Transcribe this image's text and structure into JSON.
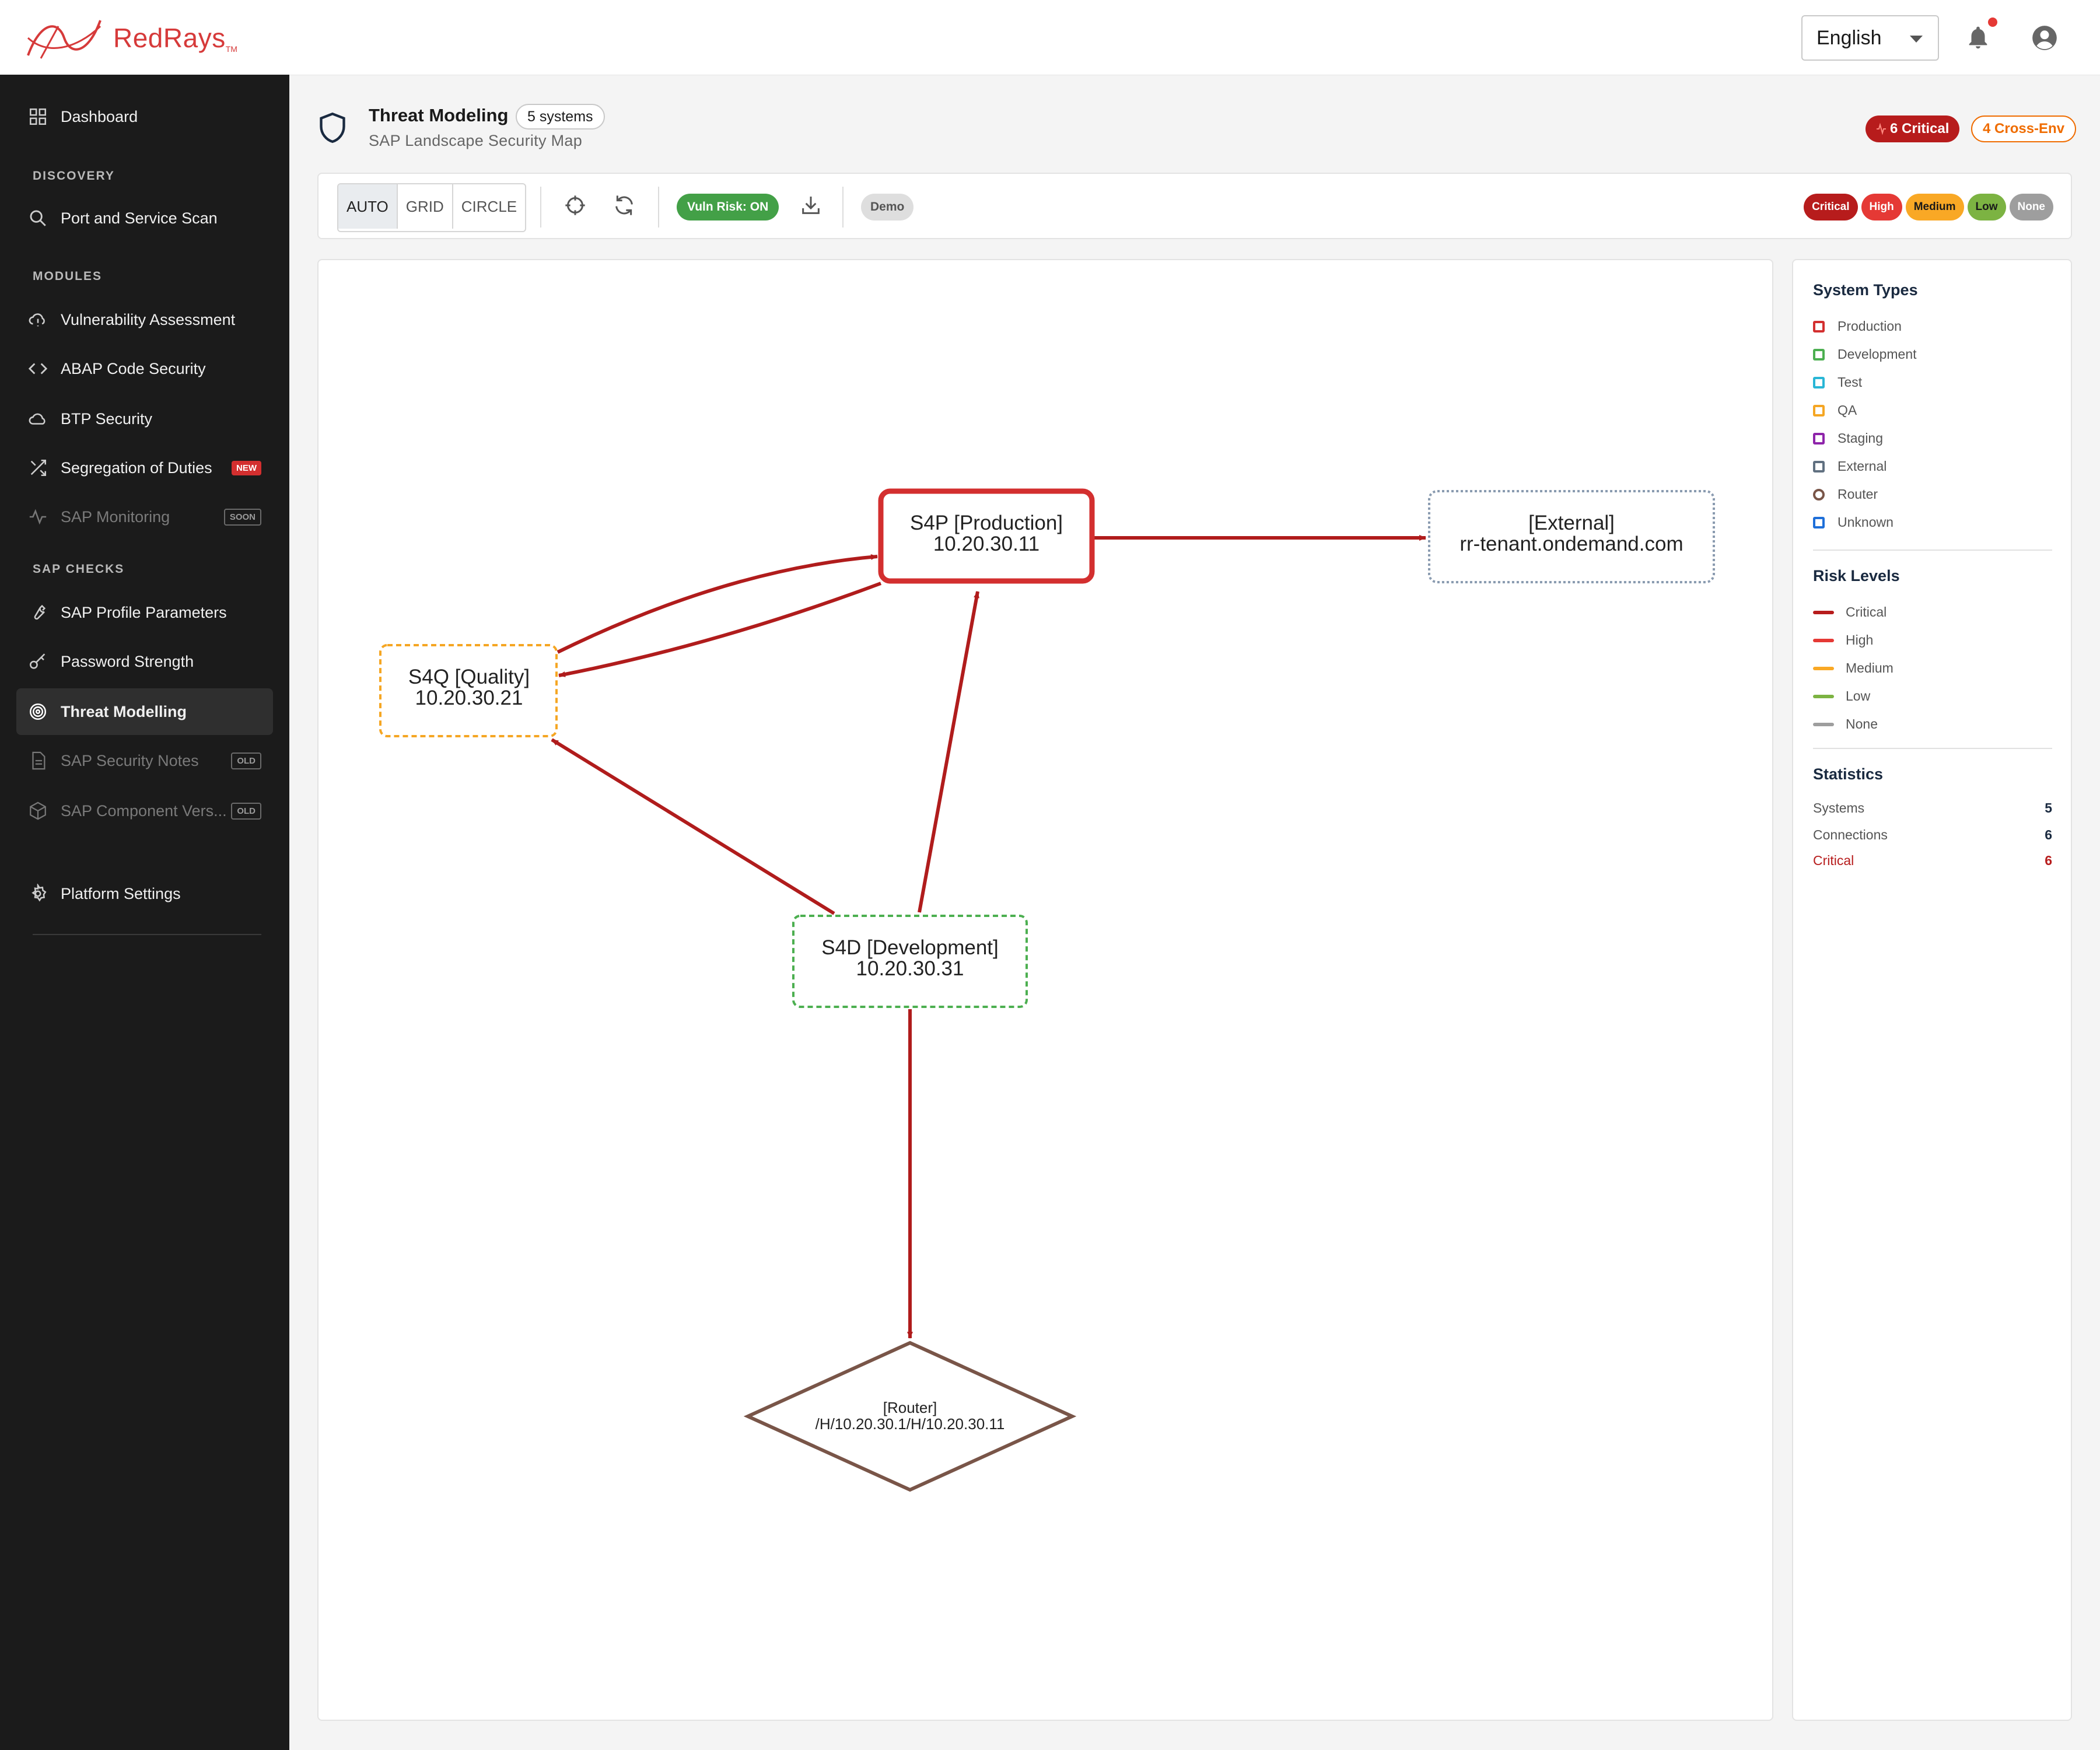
{
  "brand": {
    "name": "RedRays",
    "tm": "TM"
  },
  "header": {
    "language": "English",
    "bell_icon": "bell-icon",
    "account_icon": "account-icon"
  },
  "sidebar": {
    "dashboard": "Dashboard",
    "sections": {
      "discovery": "DISCOVERY",
      "modules": "MODULES",
      "sap_checks": "SAP CHECKS"
    },
    "items": {
      "port_scan": "Port and Service Scan",
      "vuln": "Vulnerability Assessment",
      "abap": "ABAP Code Security",
      "btp": "BTP Security",
      "sod": "Segregation of Duties",
      "sod_tag": "NEW",
      "monitoring": "SAP Monitoring",
      "monitoring_tag": "SOON",
      "profile": "SAP Profile Parameters",
      "password": "Password Strength",
      "threat": "Threat Modelling",
      "notes": "SAP Security Notes",
      "notes_tag": "OLD",
      "component": "SAP Component Vers...",
      "component_tag": "OLD",
      "settings": "Platform Settings"
    }
  },
  "page": {
    "title": "Threat Modeling",
    "count": "5 systems",
    "subtitle": "SAP Landscape Security Map",
    "critical_badge": "6 Critical",
    "cross_badge": "4 Cross-Env"
  },
  "toolbar": {
    "layouts": [
      "AUTO",
      "GRID",
      "CIRCLE"
    ],
    "active_layout": "AUTO",
    "vuln_risk": "Vuln Risk: ON",
    "demo": "Demo",
    "risk_pills": [
      {
        "label": "Critical",
        "bg": "#b71c1c",
        "fg": "#ffffff"
      },
      {
        "label": "High",
        "bg": "#e53935",
        "fg": "#ffffff"
      },
      {
        "label": "Medium",
        "bg": "#f9a825",
        "fg": "#1a1a1a"
      },
      {
        "label": "Low",
        "bg": "#7cb342",
        "fg": "#1a1a1a"
      },
      {
        "label": "None",
        "bg": "#9e9e9e",
        "fg": "#ffffff"
      }
    ]
  },
  "graph": {
    "nodes": {
      "s4p": {
        "line1": "S4P [Production]",
        "line2": "10.20.30.11",
        "color": "#d32f2f"
      },
      "ext": {
        "line1": "[External]",
        "line2": "rr-tenant.ondemand.com",
        "color": "#8a9bb0"
      },
      "s4q": {
        "line1": "S4Q [Quality]",
        "line2": "10.20.30.21",
        "color": "#f5a623"
      },
      "s4d": {
        "line1": "S4D [Development]",
        "line2": "10.20.30.31",
        "color": "#4caf50"
      },
      "router": {
        "line1": "[Router]",
        "line2": "/H/10.20.30.1/H/10.20.30.11",
        "color": "#795548"
      }
    },
    "edge_color": "#b01c1c"
  },
  "legend": {
    "system_types_title": "System Types",
    "system_types": [
      {
        "label": "Production",
        "color": "#d32f2f"
      },
      {
        "label": "Development",
        "color": "#4caf50"
      },
      {
        "label": "Test",
        "color": "#29b6d6"
      },
      {
        "label": "QA",
        "color": "#f5a623"
      },
      {
        "label": "Staging",
        "color": "#8e24aa"
      },
      {
        "label": "External",
        "color": "#607080"
      },
      {
        "label": "Router",
        "color": "#795548"
      },
      {
        "label": "Unknown",
        "color": "#1e6fd9"
      }
    ],
    "risk_levels_title": "Risk Levels",
    "risk_levels": [
      {
        "label": "Critical",
        "color": "#b71c1c"
      },
      {
        "label": "High",
        "color": "#e53935"
      },
      {
        "label": "Medium",
        "color": "#f9a825"
      },
      {
        "label": "Low",
        "color": "#7cb342"
      },
      {
        "label": "None",
        "color": "#9e9e9e"
      }
    ],
    "statistics_title": "Statistics",
    "stats": {
      "systems_label": "Systems",
      "systems_value": "5",
      "connections_label": "Connections",
      "connections_value": "6",
      "critical_label": "Critical",
      "critical_value": "6"
    }
  }
}
